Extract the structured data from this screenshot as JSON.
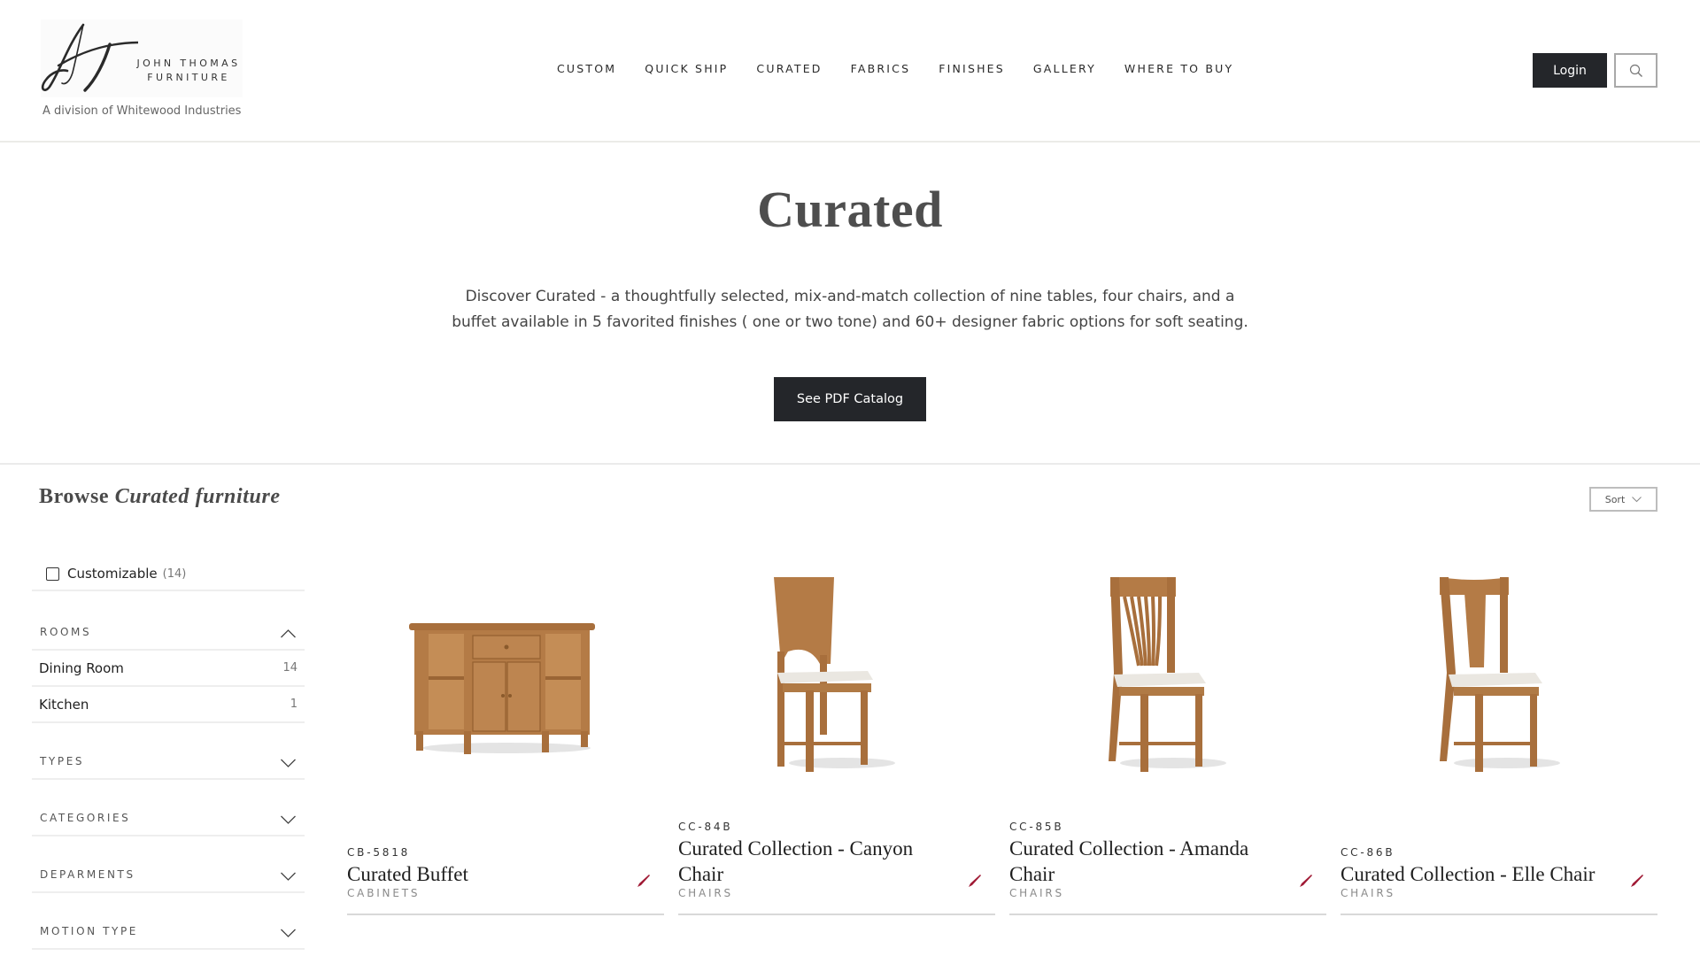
{
  "brand": {
    "monogram": "JT",
    "name_line1": "JOHN THOMAS",
    "name_line2": "FURNITURE",
    "tagline": "A division of Whitewood Industries"
  },
  "nav": {
    "items": [
      {
        "label": "CUSTOM"
      },
      {
        "label": "QUICK SHIP"
      },
      {
        "label": "CURATED"
      },
      {
        "label": "FABRICS"
      },
      {
        "label": "FINISHES"
      },
      {
        "label": "GALLERY"
      },
      {
        "label": "WHERE TO BUY"
      }
    ],
    "login_label": "Login",
    "search_icon": "search-icon"
  },
  "hero": {
    "title": "Curated",
    "description": "Discover Curated - a thoughtfully selected, mix-and-match collection of nine tables, four chairs, and a buffet available in 5 favorited finishes ( one or two tone) and 60+ designer fabric options for soft seating.",
    "catalog_button": "See PDF Catalog"
  },
  "browse": {
    "title_prefix": "Browse",
    "title_italic": "Curated furniture",
    "sort_label": "Sort"
  },
  "filters": {
    "customizable": {
      "label": "Customizable",
      "count": "(14)",
      "checked": false
    },
    "facets": [
      {
        "label": "ROOMS",
        "expanded": true,
        "options": [
          {
            "label": "Dining Room",
            "count": "14"
          },
          {
            "label": "Kitchen",
            "count": "1"
          }
        ]
      },
      {
        "label": "TYPES",
        "expanded": false
      },
      {
        "label": "CATEGORIES",
        "expanded": false
      },
      {
        "label": "DEPARMENTS",
        "expanded": false
      },
      {
        "label": "MOTION TYPE",
        "expanded": false
      }
    ]
  },
  "products": [
    {
      "sku": "CB-5818",
      "name": "Curated Buffet",
      "category": "CABINETS",
      "image": "buffet"
    },
    {
      "sku": "CC-84B",
      "name": "Curated Collection - Canyon Chair",
      "category": "CHAIRS",
      "image": "canyon-chair"
    },
    {
      "sku": "CC-85B",
      "name": "Curated Collection - Amanda Chair",
      "category": "CHAIRS",
      "image": "amanda-chair"
    },
    {
      "sku": "CC-86B",
      "name": "Curated Collection - Elle Chair",
      "category": "CHAIRS",
      "image": "elle-chair"
    }
  ],
  "colors": {
    "dark_button": "#24262a",
    "accent_red": "#a01a35",
    "wood": "#b07a45",
    "upholstery": "#e8e6e0"
  }
}
